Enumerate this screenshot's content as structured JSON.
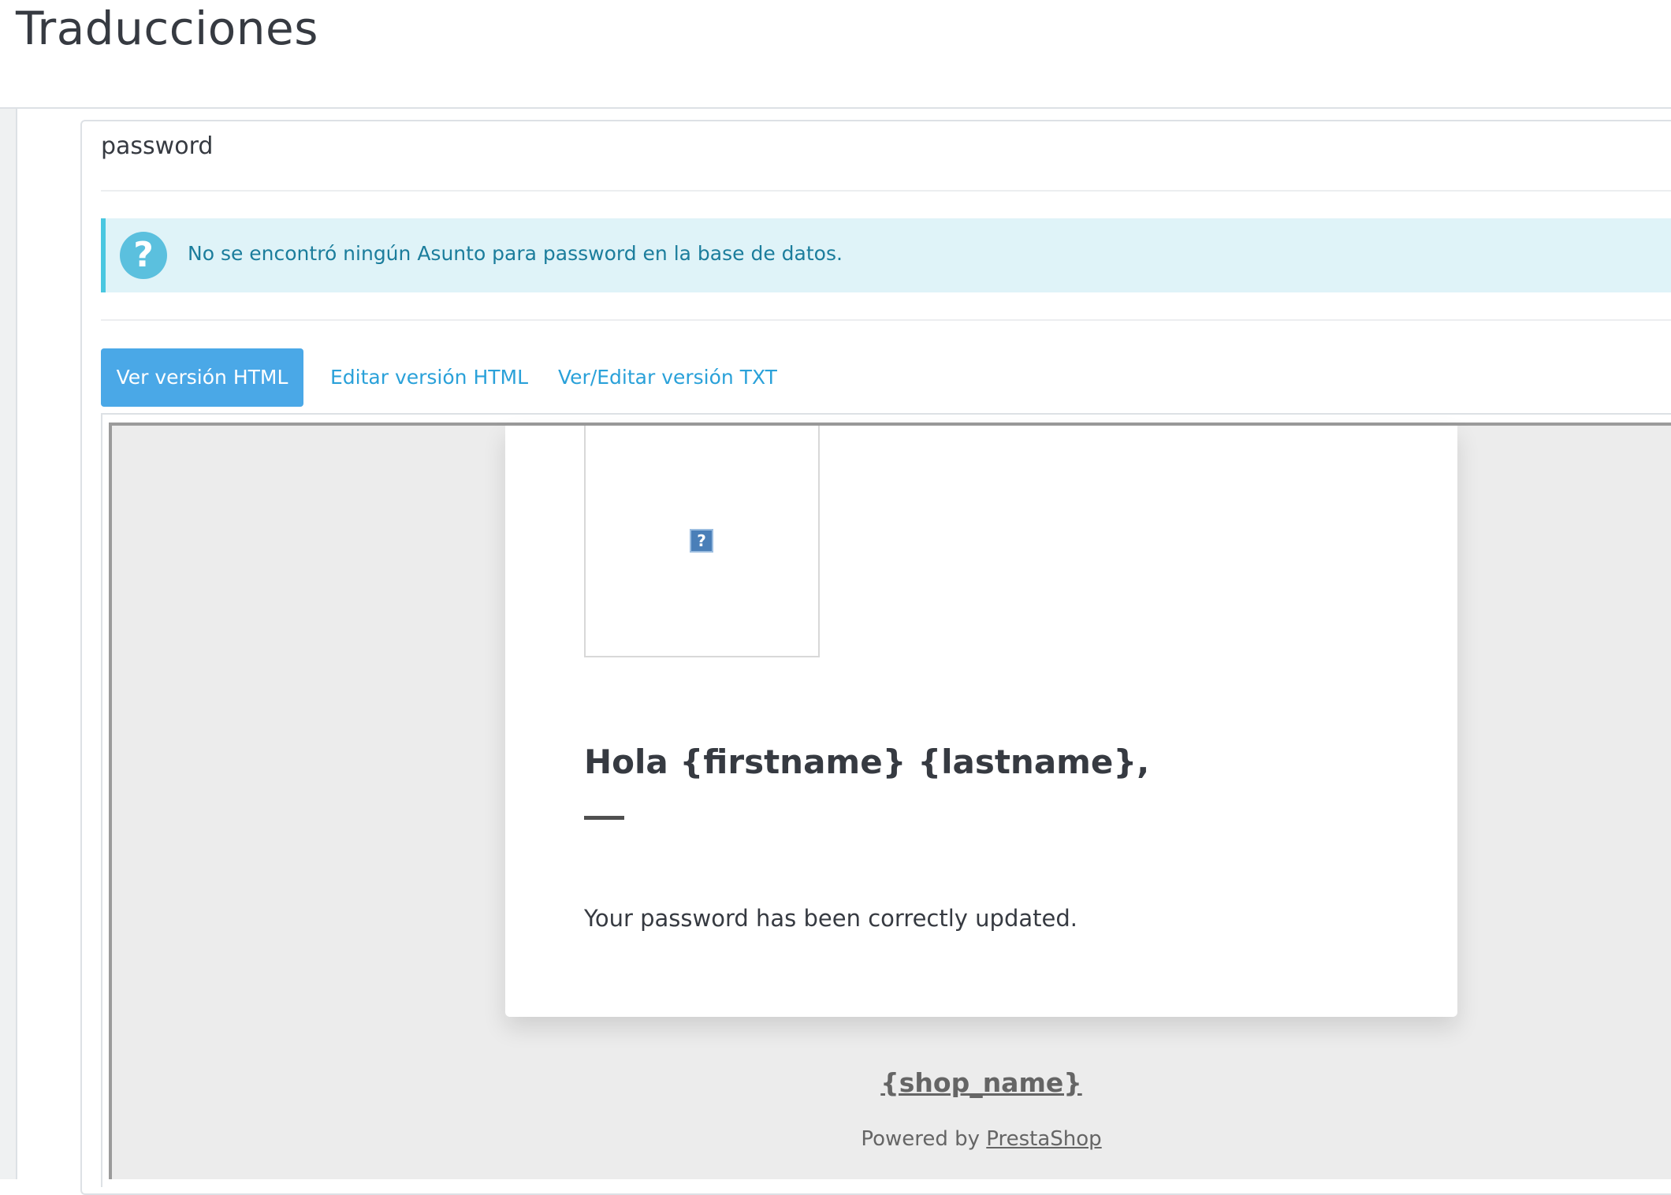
{
  "header": {
    "title": "Traducciones"
  },
  "panel": {
    "heading": "password",
    "alert": {
      "icon": "question-circle-icon",
      "text": "No se encontró ningún Asunto para password en la base de datos."
    },
    "tabs": [
      {
        "label": "Ver versión HTML",
        "active": true
      },
      {
        "label": "Editar versión HTML",
        "active": false
      },
      {
        "label": "Ver/Editar versión TXT",
        "active": false
      }
    ]
  },
  "preview": {
    "logo_placeholder": "?",
    "greeting": "Hola {firstname} {lastname},",
    "body": "Your password has been correctly updated.",
    "shop_name": "{shop_name}",
    "powered_by_prefix": "Powered by ",
    "powered_by_link": "PrestaShop"
  },
  "colors": {
    "accent": "#4aa8e7",
    "alert_bg": "#dff3f8",
    "alert_text": "#1b7d9c",
    "link": "#2aa1d9"
  }
}
